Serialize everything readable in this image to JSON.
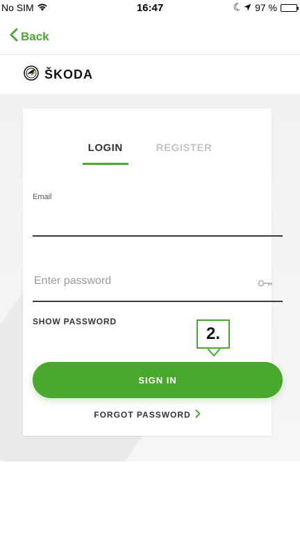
{
  "status_bar": {
    "carrier": "No SIM",
    "time": "16:47",
    "battery": "97 %"
  },
  "nav": {
    "back_label": "Back"
  },
  "brand": {
    "name": "ŠKODA"
  },
  "tabs": [
    {
      "label": "LOGIN",
      "active": true
    },
    {
      "label": "REGISTER",
      "active": false
    }
  ],
  "form": {
    "email_label": "Email",
    "email_value": "",
    "password_placeholder": "Enter password",
    "show_password_label": "SHOW PASSWORD",
    "sign_in_label": "SIGN IN",
    "forgot_password_label": "FORGOT PASSWORD"
  },
  "callout": {
    "step": "2."
  },
  "colors": {
    "accent": "#4ba82e"
  },
  "icons": [
    "wifi-icon",
    "moon-icon",
    "location-arrow-icon",
    "battery-icon",
    "chevron-left-icon",
    "skoda-logo-icon",
    "key-icon",
    "chevron-right-icon"
  ]
}
